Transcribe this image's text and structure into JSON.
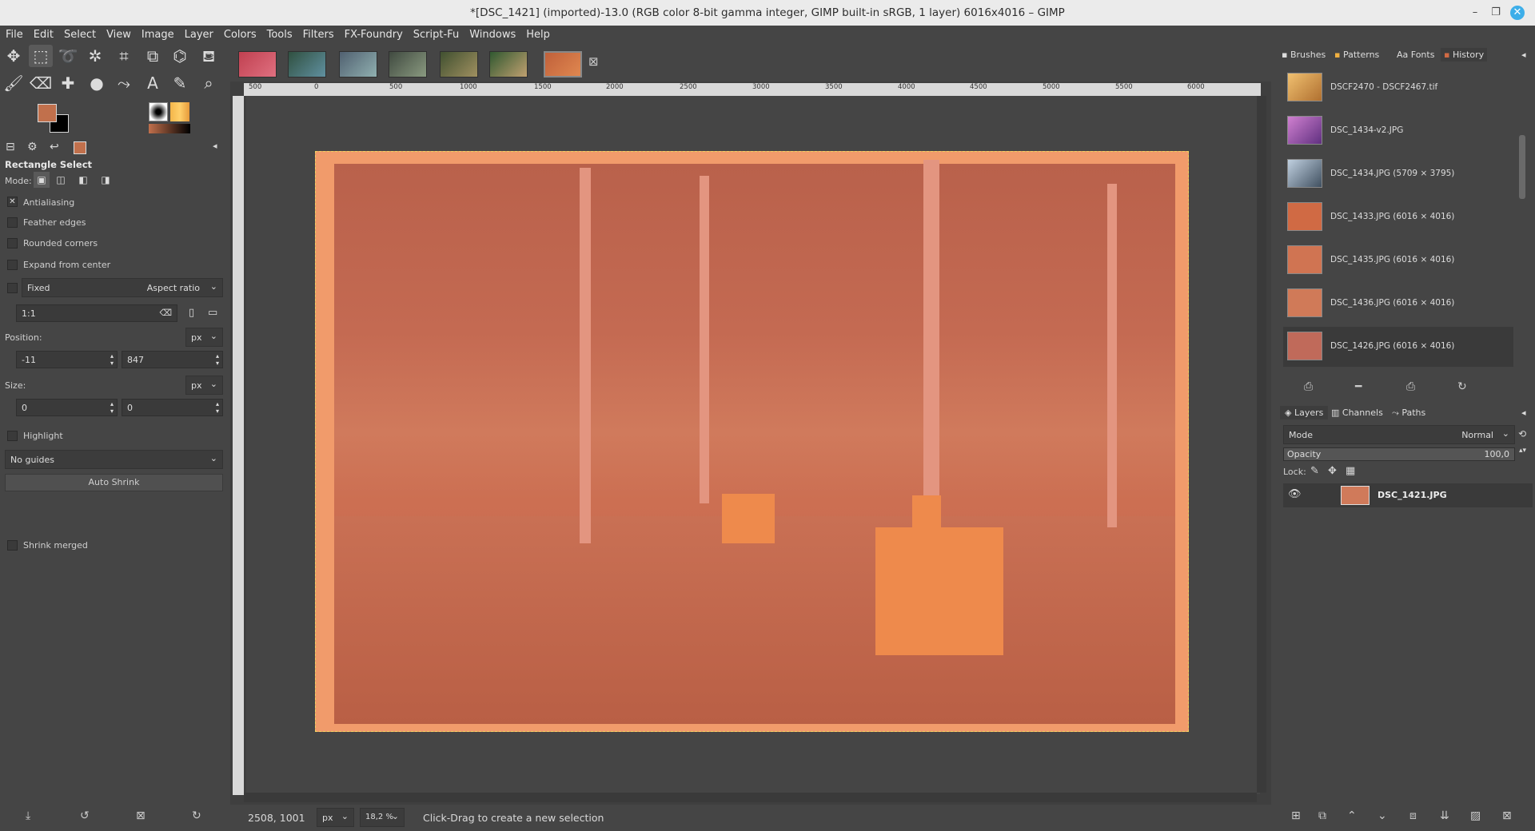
{
  "window": {
    "title": "*[DSC_1421] (imported)-13.0 (RGB color 8-bit gamma integer, GIMP built-in sRGB, 1 layer) 6016x4016 – GIMP"
  },
  "menu": [
    "File",
    "Edit",
    "Select",
    "View",
    "Image",
    "Layer",
    "Colors",
    "Tools",
    "Filters",
    "FX-Foundry",
    "Script-Fu",
    "Windows",
    "Help"
  ],
  "colors": {
    "foreground": "#c1704c",
    "background": "#000000",
    "accent": "#3daee9"
  },
  "tool_options": {
    "title": "Rectangle Select",
    "mode_label": "Mode:",
    "antialiasing": "Antialiasing",
    "feather_edges": "Feather edges",
    "rounded_corners": "Rounded corners",
    "expand_from_center": "Expand from center",
    "fixed_label": "Fixed",
    "fixed_value": "Aspect ratio",
    "ratio_value": "1:1",
    "position_label": "Position:",
    "position_unit": "px",
    "pos_x": "-11",
    "pos_y": "847",
    "size_label": "Size:",
    "size_unit": "px",
    "size_w": "0",
    "size_h": "0",
    "highlight": "Highlight",
    "guides": "No guides",
    "auto_shrink": "Auto Shrink",
    "shrink_merged": "Shrink merged"
  },
  "ruler_labels": [
    "500",
    "0",
    "500",
    "1000",
    "1500",
    "2000",
    "2500",
    "3000",
    "3500",
    "4000",
    "4500",
    "5000",
    "5500",
    "6000"
  ],
  "status": {
    "coords": "2508, 1001",
    "unit": "px",
    "zoom": "18,2 %",
    "message": "Click-Drag to create a new selection"
  },
  "right_tabs": {
    "brushes": "Brushes",
    "patterns": "Patterns",
    "fonts": "Fonts",
    "history": "History"
  },
  "history": [
    {
      "label": "DSCF2470 - DSCF2467.tif",
      "color": "#d8a050"
    },
    {
      "label": "DSC_1434-v2.JPG",
      "color": "#b070c0"
    },
    {
      "label": "DSC_1434.JPG (5709 × 3795)",
      "color": "#8aa0b0"
    },
    {
      "label": "DSC_1433.JPG (6016 × 4016)",
      "color": "#d06a44"
    },
    {
      "label": "DSC_1435.JPG (6016 × 4016)",
      "color": "#d07452"
    },
    {
      "label": "DSC_1436.JPG (6016 × 4016)",
      "color": "#d07a58"
    },
    {
      "label": "DSC_1426.JPG (6016 × 4016)",
      "color": "#c06a5a"
    }
  ],
  "layers_tabs": {
    "layers": "Layers",
    "channels": "Channels",
    "paths": "Paths"
  },
  "layers": {
    "mode_label": "Mode",
    "mode_value": "Normal",
    "opacity_label": "Opacity",
    "opacity_value": "100,0",
    "lock_label": "Lock:",
    "layer_name": "DSC_1421.JPG"
  }
}
